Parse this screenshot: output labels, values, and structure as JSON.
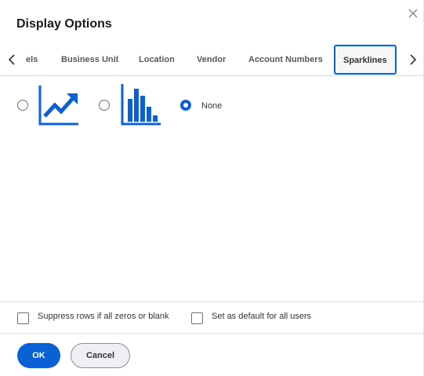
{
  "dialog": {
    "title": "Display Options"
  },
  "tabs": [
    {
      "label": "els"
    },
    {
      "label": "Business Unit"
    },
    {
      "label": "Location"
    },
    {
      "label": "Vendor"
    },
    {
      "label": "Account Numbers"
    },
    {
      "label": "Sparklines",
      "active": true
    }
  ],
  "sparklines": {
    "options": [
      {
        "icon": "line-chart-icon",
        "selected": false
      },
      {
        "icon": "bar-chart-icon",
        "selected": false
      },
      {
        "label": "None",
        "selected": true
      }
    ]
  },
  "options": {
    "suppress_label": "Suppress rows if all zeros or blank",
    "default_label": "Set as default for all users"
  },
  "buttons": {
    "ok_label": "OK",
    "cancel_label": "Cancel"
  },
  "colors": {
    "accent": "#0a61d4"
  }
}
